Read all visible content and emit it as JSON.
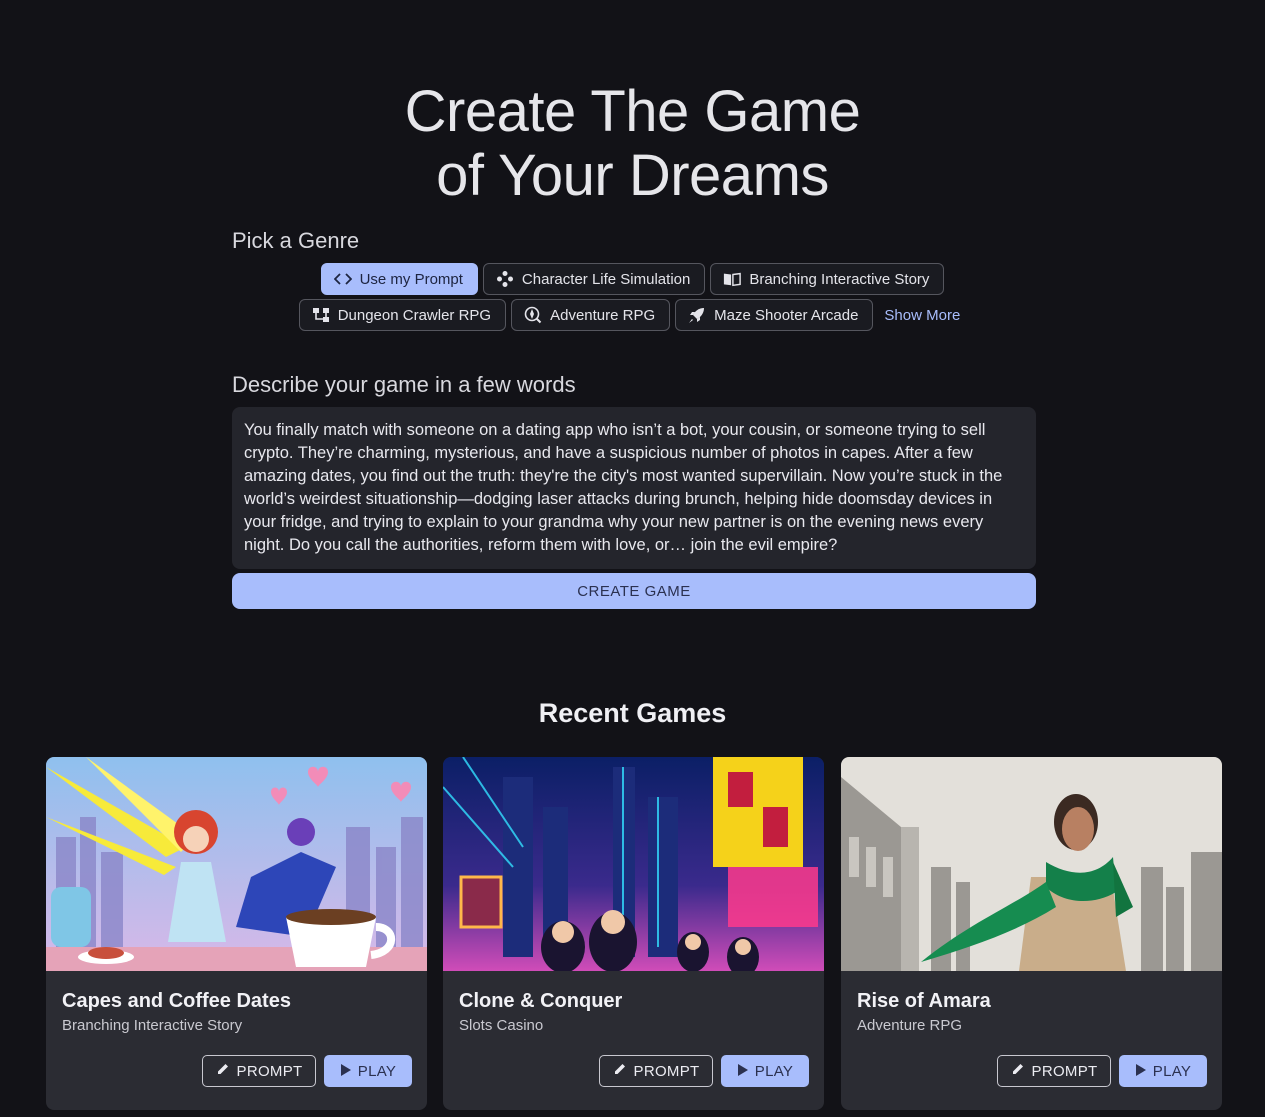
{
  "hero": {
    "line1": "Create The Game",
    "line2": "of Your Dreams"
  },
  "genre_section": {
    "label": "Pick a Genre",
    "chips": [
      {
        "label": "Use my Prompt",
        "icon": "code-icon",
        "active": true
      },
      {
        "label": "Character Life Simulation",
        "icon": "gamepad-icon",
        "active": false
      },
      {
        "label": "Branching Interactive Story",
        "icon": "book-icon",
        "active": false
      },
      {
        "label": "Dungeon Crawler RPG",
        "icon": "dungeon-map-icon",
        "active": false
      },
      {
        "label": "Adventure RPG",
        "icon": "compass-icon",
        "active": false
      },
      {
        "label": "Maze Shooter Arcade",
        "icon": "rocket-icon",
        "active": false
      }
    ],
    "show_more": "Show More"
  },
  "describe": {
    "label": "Describe your game in a few words",
    "text": "You finally match with someone on a dating app who isn’t a bot, your cousin, or someone trying to sell crypto. They’re charming, mysterious, and have a suspicious number of photos in capes. After a few amazing dates, you find out the truth: they're the city's most wanted supervillain. Now you’re stuck in the world’s weirdest situationship—dodging laser attacks during brunch, helping hide doomsday devices in your fridge, and trying to explain to your grandma why your new partner is on the evening news every night. Do you call the authorities, reform them with love, or… join the evil empire?",
    "create_label": "CREATE GAME"
  },
  "recent": {
    "title": "Recent Games",
    "prompt_label": "PROMPT",
    "play_label": "PLAY",
    "games": [
      {
        "title": "Capes and Coffee Dates",
        "genre": "Branching Interactive Story"
      },
      {
        "title": "Clone & Conquer",
        "genre": "Slots Casino"
      },
      {
        "title": "Rise of Amara",
        "genre": "Adventure RPG"
      }
    ]
  },
  "colors": {
    "accent": "#a8bdfc",
    "background": "#121217",
    "card": "#2b2c33"
  }
}
